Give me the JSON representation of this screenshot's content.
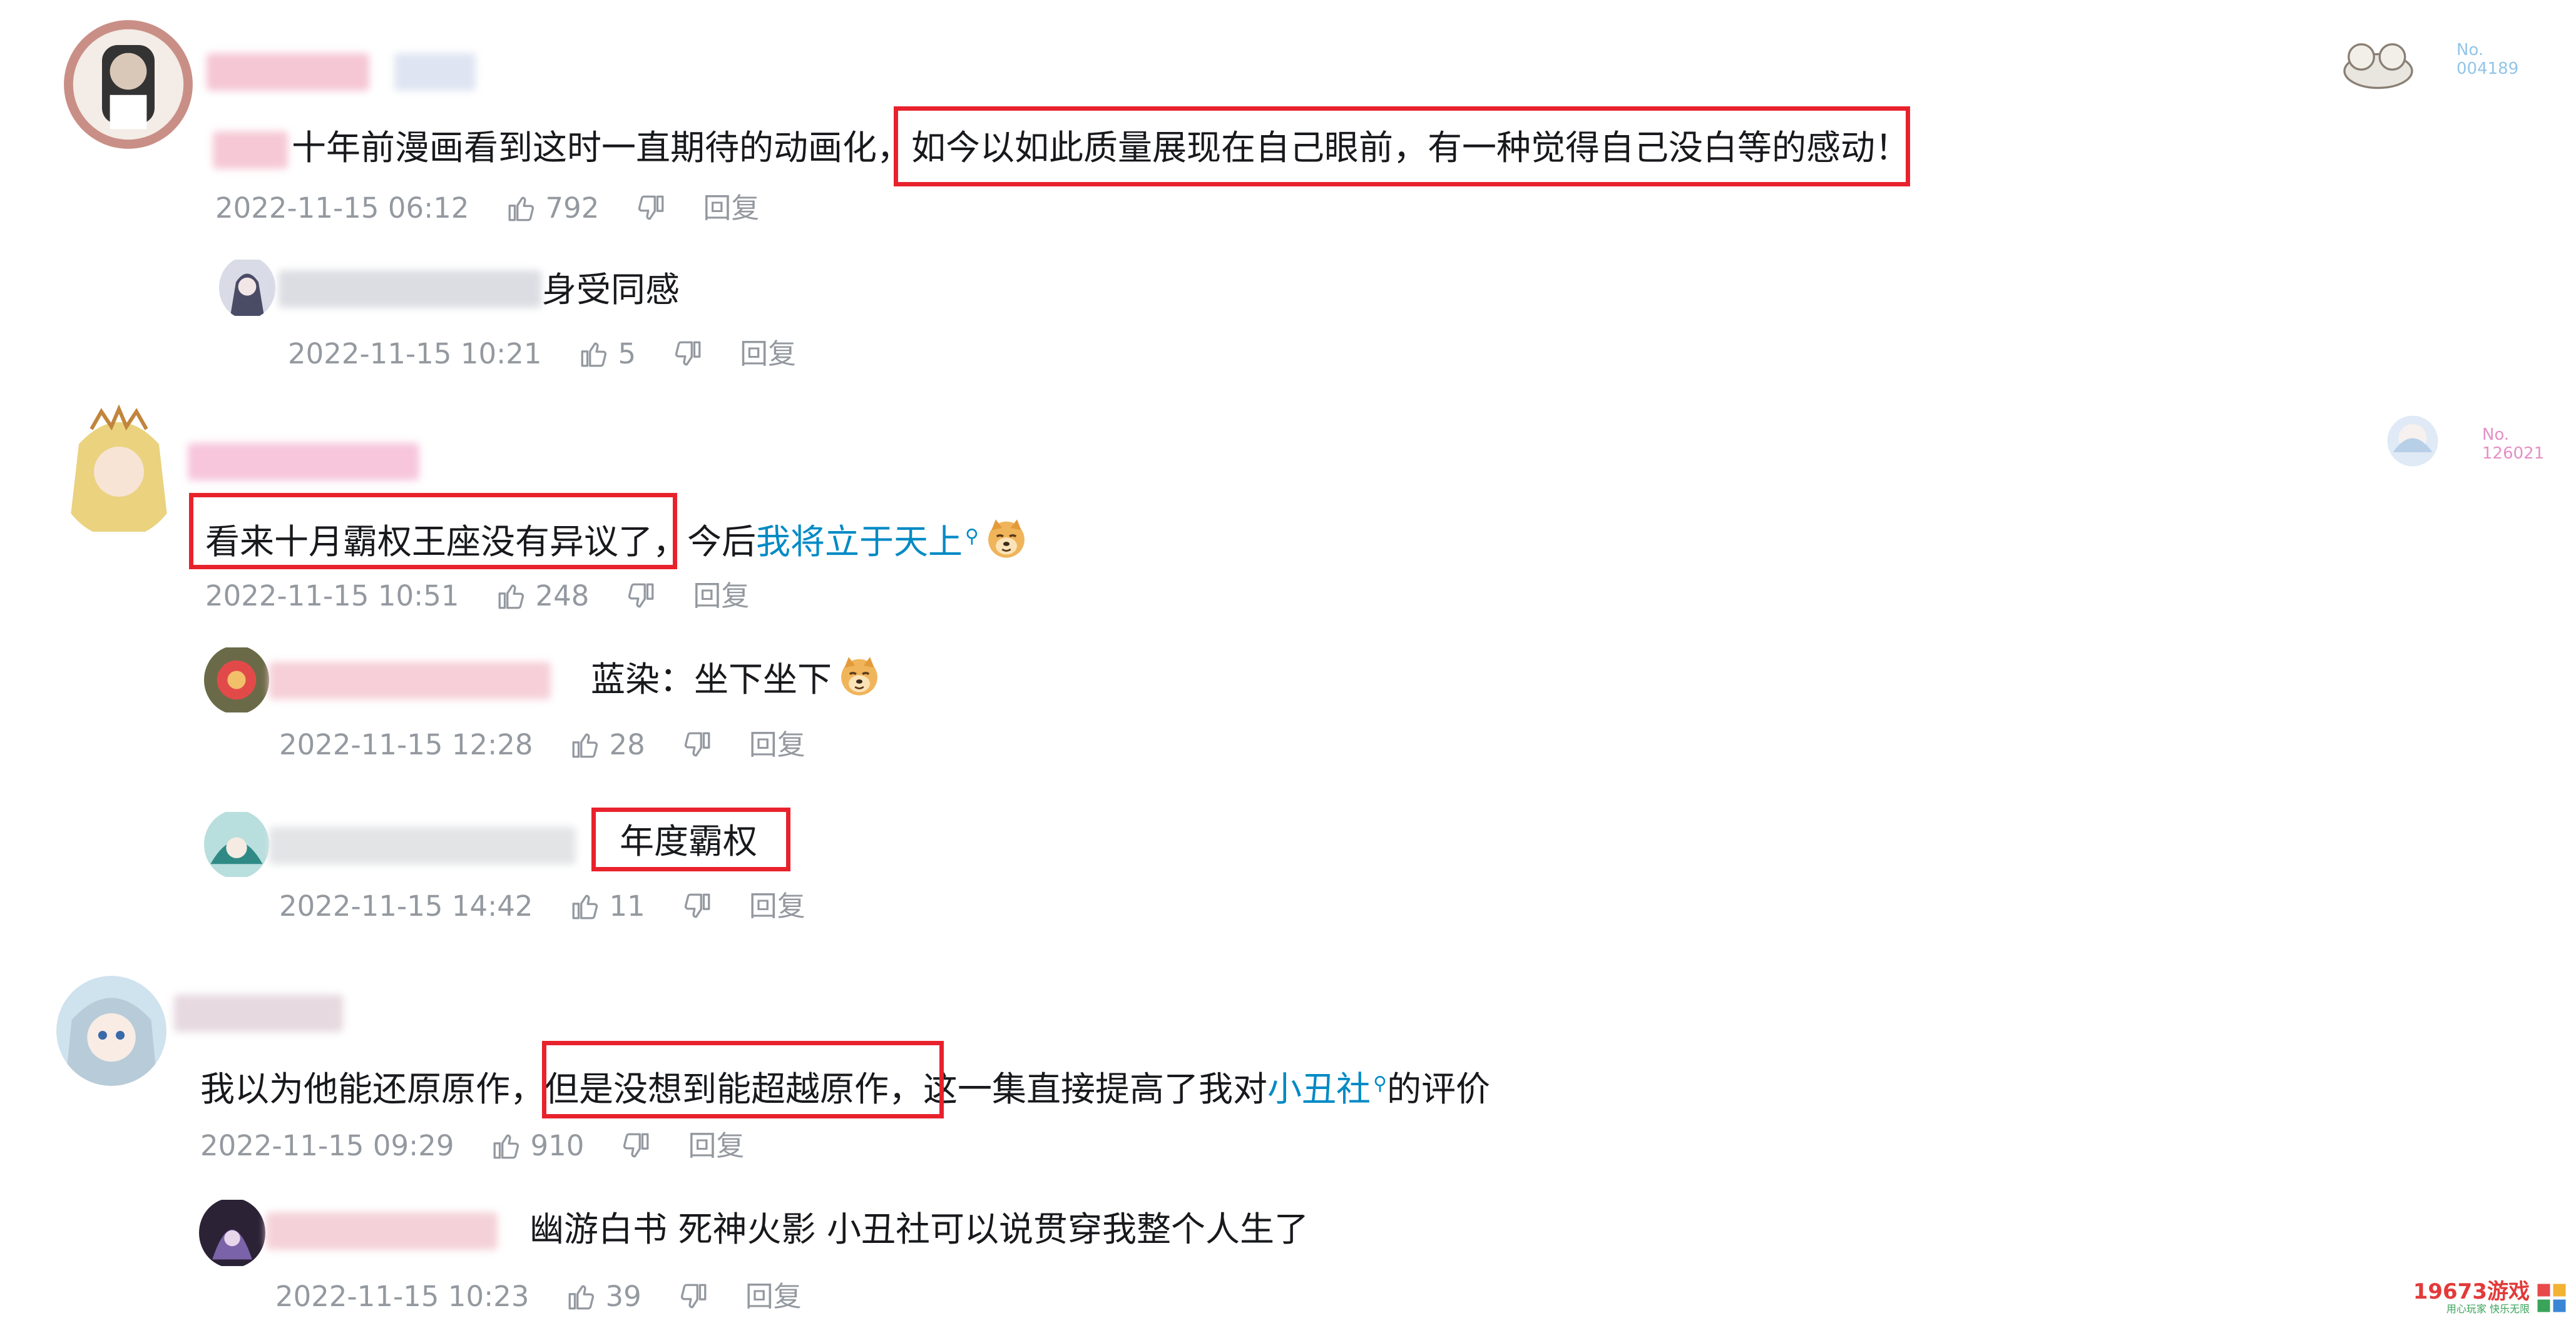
{
  "comments": [
    {
      "text_prefix": "十年前漫画看到这时一直期待的动画化，",
      "text_highlight": "如今以如此质量展现在自己眼前，有一种觉得自己没白等的感动！",
      "time": "2022-11-15 06:12",
      "likes": "792",
      "reply_label": "回复",
      "badge": {
        "line1": "No.",
        "line2": "004189"
      },
      "replies": [
        {
          "text": "身受同感",
          "time": "2022-11-15 10:21",
          "likes": "5",
          "reply_label": "回复"
        }
      ]
    },
    {
      "text_highlight": "看来十月霸权王座没有异议了",
      "text_middle": "，今后",
      "link_text": "我将立于天上",
      "time": "2022-11-15 10:51",
      "likes": "248",
      "reply_label": "回复",
      "badge": {
        "line1": "No.",
        "line2": "126021"
      },
      "replies": [
        {
          "text": "蓝染：坐下坐下",
          "time": "2022-11-15 12:28",
          "likes": "28",
          "reply_label": "回复"
        },
        {
          "text": "年度霸权",
          "time": "2022-11-15 14:42",
          "likes": "11",
          "reply_label": "回复"
        }
      ]
    },
    {
      "text_prefix": "我以为他能还原原作，",
      "text_highlight": "但是没想到能超越原作，",
      "text_middle": "这一集直接提高了我对",
      "link_text": "小丑社",
      "text_suffix": "的评价",
      "time": "2022-11-15 09:29",
      "likes": "910",
      "reply_label": "回复",
      "replies": [
        {
          "text": "幽游白书 死神火影 小丑社可以说贯穿我整个人生了",
          "time": "2022-11-15 10:23",
          "likes": "39",
          "reply_label": "回复"
        }
      ]
    }
  ],
  "watermark": {
    "brand": "19673游戏",
    "slogan": "用心玩家 快乐无限"
  },
  "colors": {
    "highlight_border": "#e8222c",
    "link": "#008ac5",
    "meta": "#9499a0",
    "text": "#18191c"
  },
  "icons": {
    "like": "thumbs-up-icon",
    "dislike": "thumbs-down-icon",
    "search": "search-icon"
  }
}
